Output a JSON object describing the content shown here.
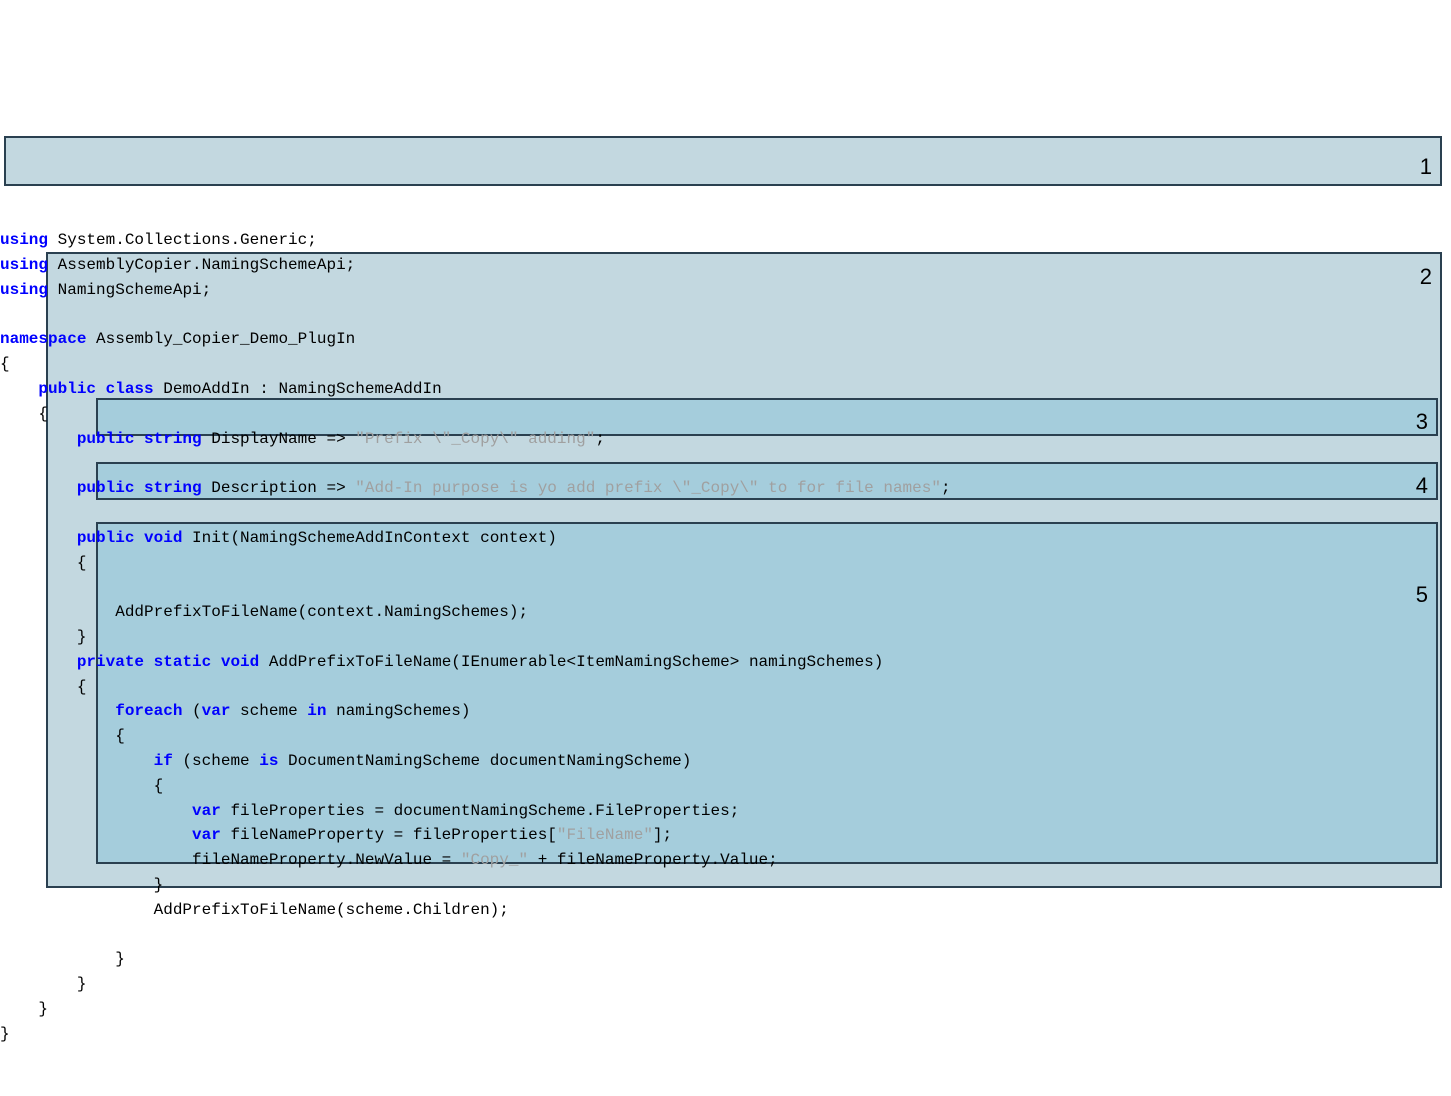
{
  "code": {
    "l1a": "using",
    "l1b": " System.Collections.Generic;",
    "l2a": "using",
    "l2b": " AssemblyCopier.NamingSchemeApi;",
    "l3a": "using",
    "l3b": " NamingSchemeApi;",
    "l5a": "namespace",
    "l5b": " Assembly_Copier_Demo_PlugIn",
    "l6": "{",
    "l7a": "    public",
    "l7b": " class",
    "l7c": " DemoAddIn : NamingSchemeAddIn",
    "l8": "    {",
    "l9a": "        public",
    "l9b": " string",
    "l9c": " DisplayName => ",
    "l9d": "\"Prefix \\\"_Copy\\\" adding\"",
    "l9e": ";",
    "l11a": "        public",
    "l11b": " string",
    "l11c": " Description => ",
    "l11d": "\"Add-In purpose is yo add prefix \\\"_Copy\\\" to for file names\"",
    "l11e": ";",
    "l13a": "        public",
    "l13b": " void",
    "l13c": " Init(NamingSchemeAddInContext context)",
    "l14": "        {",
    "l16": "            AddPrefixToFileName(context.NamingSchemes);",
    "l17": "        }",
    "l18a": "        private",
    "l18b": " static",
    "l18c": " void",
    "l18d": " AddPrefixToFileName(IEnumerable<ItemNamingScheme> namingSchemes)",
    "l19": "        {",
    "l20a": "            foreach",
    "l20b": " (",
    "l20c": "var",
    "l20d": " scheme ",
    "l20e": "in",
    "l20f": " namingSchemes)",
    "l21": "            {",
    "l22a": "                if",
    "l22b": " (scheme ",
    "l22c": "is",
    "l22d": " DocumentNamingScheme documentNamingScheme)",
    "l23": "                {",
    "l24a": "                    var",
    "l24b": " fileProperties = documentNamingScheme.FileProperties;",
    "l25a": "                    var",
    "l25b": " fileNameProperty = fileProperties[",
    "l25c": "\"FileName\"",
    "l25d": "];",
    "l26a": "                    fileNameProperty.NewValue = ",
    "l26b": "\"Copy_\"",
    "l26c": " + fileNameProperty.Value;",
    "l27": "                }",
    "l28": "                AddPrefixToFileName(scheme.Children);",
    "l30": "            }",
    "l31": "        }",
    "l32": "    }",
    "l33": "}"
  },
  "boxes": {
    "n1": "1",
    "n2": "2",
    "n3": "3",
    "n4": "4",
    "n5": "5"
  }
}
